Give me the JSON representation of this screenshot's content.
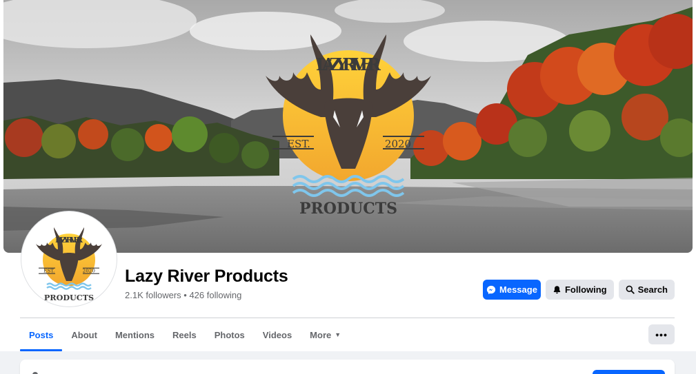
{
  "cover": {
    "logo_text_top": "LAZY RIVER",
    "logo_est_left": "EST.",
    "logo_est_right": "2020",
    "logo_bottom": "PRODUCTS"
  },
  "avatar": {
    "logo_text_top": "LAZY RIVER",
    "logo_est_left": "EST.",
    "logo_est_right": "2020",
    "logo_bottom": "PRODUCTS"
  },
  "profile": {
    "name": "Lazy River Products",
    "followers": "2.1K followers",
    "separator": " • ",
    "following": "426 following"
  },
  "actions": {
    "message": "Message",
    "following": "Following",
    "search": "Search"
  },
  "tabs": [
    {
      "label": "Posts",
      "active": true
    },
    {
      "label": "About"
    },
    {
      "label": "Mentions"
    },
    {
      "label": "Reels"
    },
    {
      "label": "Photos"
    },
    {
      "label": "Videos"
    },
    {
      "label": "More"
    }
  ],
  "overflow": {
    "label": "•••"
  },
  "colors": {
    "accent": "#0866ff",
    "logo_yellow": "#f5b632",
    "logo_brown": "#4a3f3a",
    "water_blue": "#7fc6ec"
  }
}
